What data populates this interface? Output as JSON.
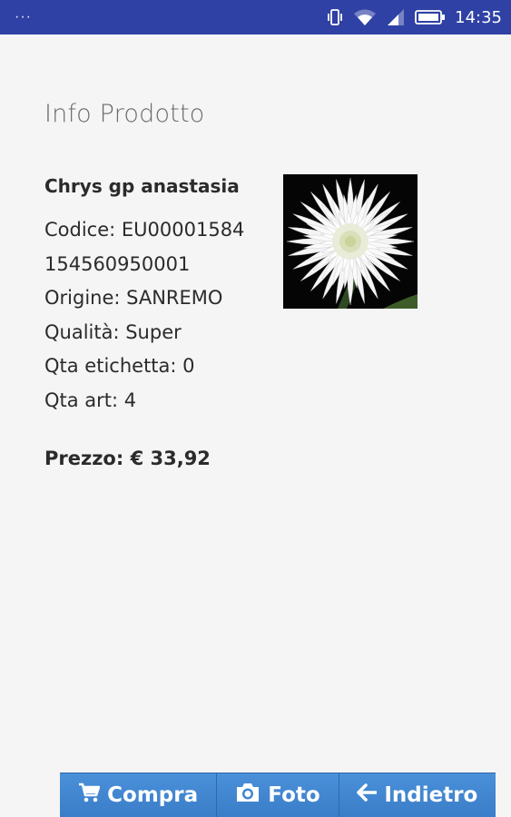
{
  "status_bar": {
    "menu_dots": "···",
    "time": "14:35",
    "icons": [
      "vibrate-icon",
      "wifi-icon",
      "signal-icon",
      "battery-icon"
    ]
  },
  "page": {
    "title": "Info Prodotto"
  },
  "product": {
    "name": "Chrys gp anastasia",
    "codice": "Codice: EU00001584",
    "barcode": "154560950001",
    "origine": "Origine: SANREMO",
    "qualita": "Qualità: Super",
    "qta_etichetta": "Qta etichetta: 0",
    "qta_art": "Qta art: 4",
    "prezzo": "Prezzo: € 33,92",
    "photo_icon": "white-chrysanthemum-photo"
  },
  "actions": {
    "compra": {
      "label": "Compra",
      "icon": "cart-icon"
    },
    "foto": {
      "label": "Foto",
      "icon": "camera-icon"
    },
    "indietro": {
      "label": "Indietro",
      "icon": "arrow-left-icon"
    }
  },
  "colors": {
    "status_bar": "#2f41a4",
    "button_bar": "#3f86d2",
    "background": "#f5f5f5"
  }
}
